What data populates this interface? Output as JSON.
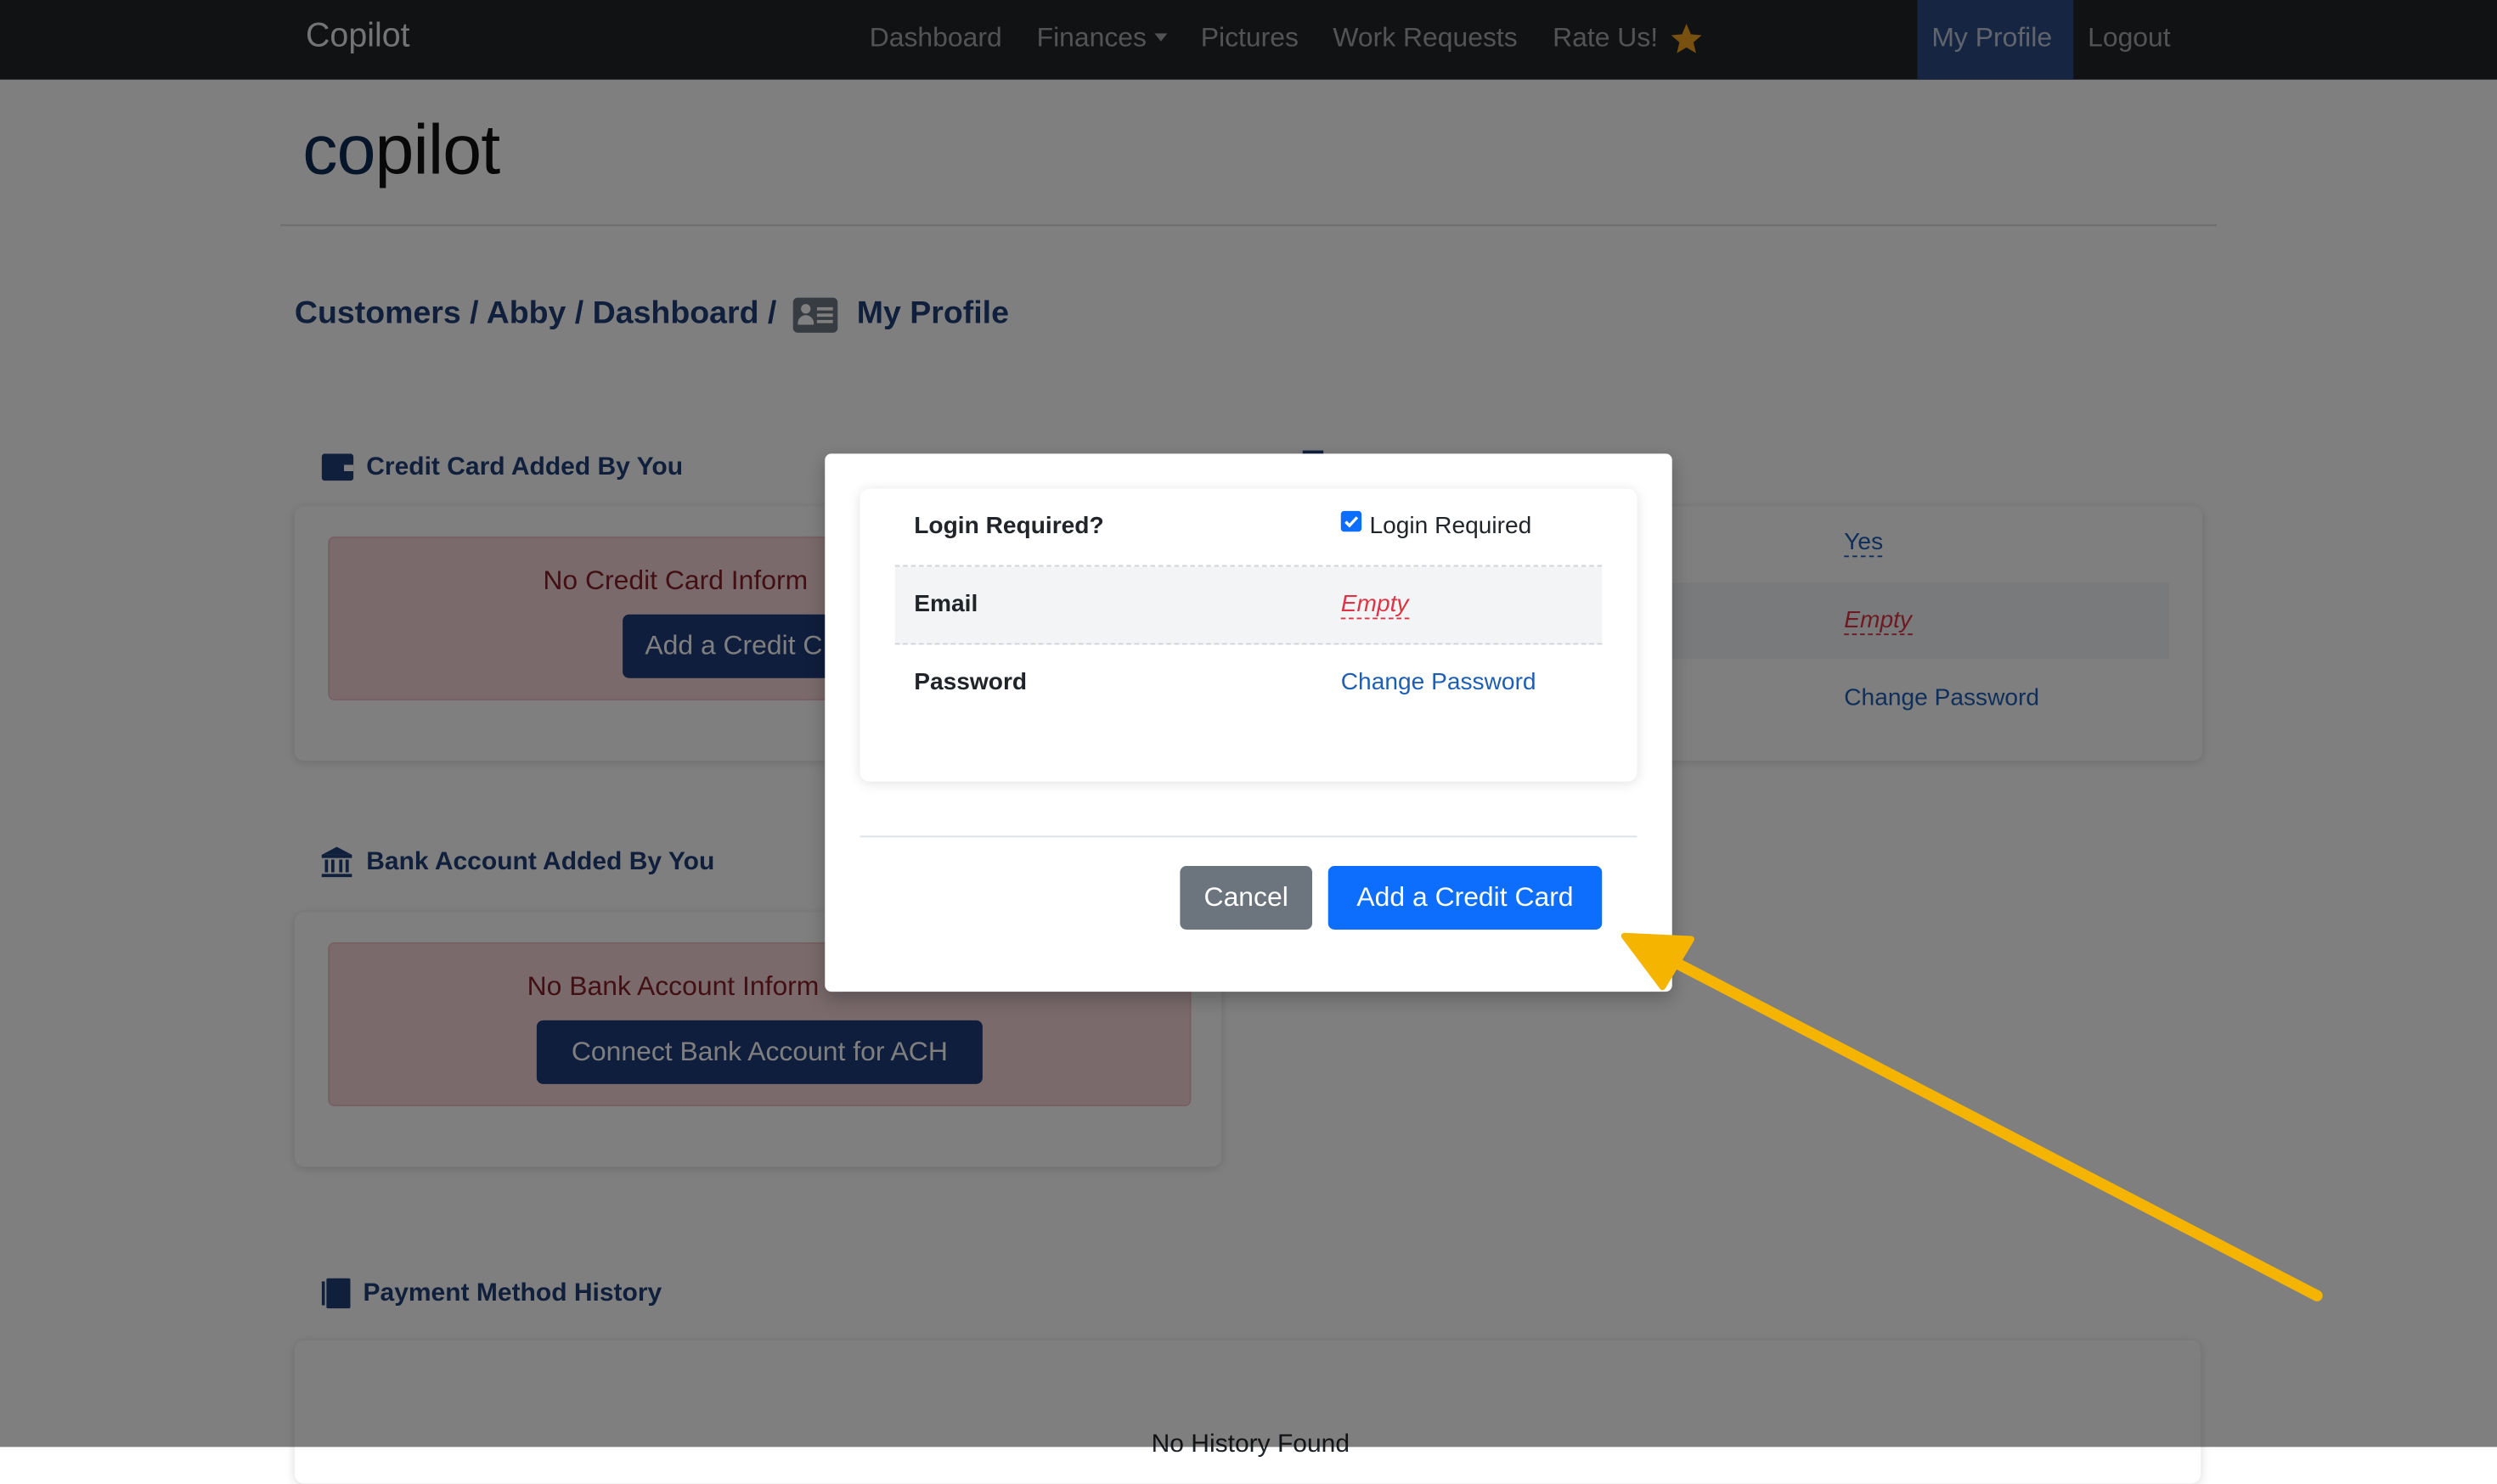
{
  "navbar": {
    "brand": "Copilot",
    "links": [
      "Dashboard",
      "Finances",
      "Pictures",
      "Work Requests",
      "Rate Us!"
    ],
    "right_links": [
      "My Profile",
      "Logout"
    ]
  },
  "logo": {
    "part1": "co",
    "part2": "pilot"
  },
  "breadcrumb": {
    "path": "Customers / Abby / Dashboard /",
    "current": "My Profile"
  },
  "credit_card_section": {
    "title": "Credit Card Added By You",
    "alert_text": "No Credit Card Inform",
    "button": "Add a Credit C"
  },
  "bank_section": {
    "title": "Bank Account Added By You",
    "alert_text": "No Bank Account Inform",
    "button": "Connect Bank Account for ACH"
  },
  "payment_history": {
    "title": "Payment Method History",
    "empty_text": "No History Found"
  },
  "background_panel": {
    "yes": "Yes",
    "empty": "Empty",
    "change_password": "Change Password"
  },
  "modal": {
    "rows": [
      {
        "label": "Login Required?",
        "checkbox_label": "Login Required",
        "checked": true
      },
      {
        "label": "Email",
        "value": "Empty"
      },
      {
        "label": "Password",
        "value": "Change Password"
      }
    ],
    "cancel": "Cancel",
    "submit": "Add a Credit Card"
  },
  "colors": {
    "navbar": "#212529",
    "accent": "#0d6efd",
    "annotation_arrow": "#f5b400"
  }
}
